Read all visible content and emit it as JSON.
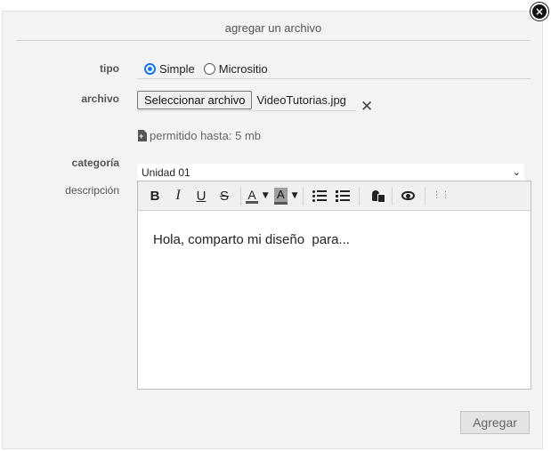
{
  "dialog": {
    "title": "agregar un archivo",
    "close_glyph": "×"
  },
  "form": {
    "tipo": {
      "label": "tipo",
      "options": [
        {
          "label": "Simple",
          "checked": true
        },
        {
          "label": "Micrositio",
          "checked": false
        }
      ]
    },
    "archivo": {
      "label": "archivo",
      "button_label": "Seleccionar archivo",
      "file_name": "VideoTutorias.jpg",
      "remove_glyph": "✕",
      "limit_text": "permitido hasta: 5 mb"
    },
    "categoria": {
      "label": "categoría",
      "selected": "Unidad 01",
      "chevron_glyph": "⌄"
    },
    "descripcion": {
      "label": "descripción",
      "toolbar": {
        "bold": "B",
        "italic": "I",
        "underline": "U",
        "strike": "S",
        "font_color": "A",
        "highlight": "A",
        "caret": "▼",
        "more": "⋮⋮"
      },
      "content": "Hola, comparto mi diseño  para..."
    },
    "submit_label": "Agregar"
  },
  "icons": {
    "close": "close-icon",
    "remove": "remove-file-icon",
    "limit": "file-upload-icon",
    "dropdown": "chevron-down-icon",
    "bullet_list": "bullet-list-icon",
    "numbered_list": "numbered-list-icon",
    "voice": "microphone-icon",
    "preview": "eye-icon"
  },
  "colors": {
    "accent": "#1a73e8",
    "dialog_bg": "#f3f3f3",
    "button_bg": "#e4e4e4"
  }
}
